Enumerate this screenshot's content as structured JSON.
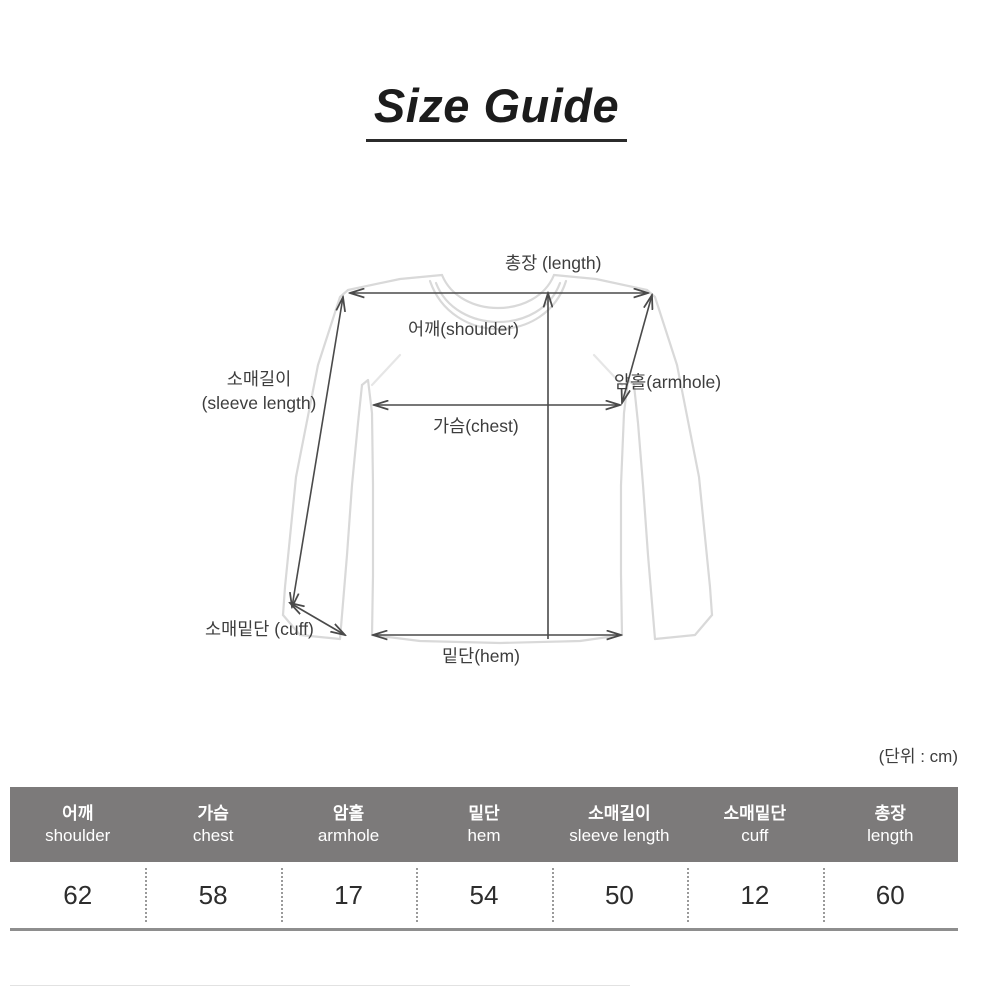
{
  "title": "Size Guide",
  "diagram": {
    "labels": {
      "length": "총장 (length)",
      "shoulder": "어깨(shoulder)",
      "sleeve_length_ko": "소매길이",
      "sleeve_length_en": "(sleeve length)",
      "armhole": "암홀(armhole)",
      "chest": "가슴(chest)",
      "cuff": "소매밑단 (cuff)",
      "hem": "밑단(hem)"
    },
    "garment": "long-sleeve-top-outline"
  },
  "unit_note": "(단위 : cm)",
  "table": {
    "columns": [
      {
        "ko": "어깨",
        "en": "shoulder"
      },
      {
        "ko": "가슴",
        "en": "chest"
      },
      {
        "ko": "암홀",
        "en": "armhole"
      },
      {
        "ko": "밑단",
        "en": "hem"
      },
      {
        "ko": "소매길이",
        "en": "sleeve length"
      },
      {
        "ko": "소매밑단",
        "en": "cuff"
      },
      {
        "ko": "총장",
        "en": "length"
      }
    ],
    "rows": [
      [
        "62",
        "58",
        "17",
        "54",
        "50",
        "12",
        "60"
      ]
    ]
  },
  "colors": {
    "header_bg": "#7c7a7a",
    "header_text": "#ffffff",
    "garment_outline": "#d8d8d8",
    "arrow": "#4a4a4a",
    "title_text": "#1c1c1c"
  }
}
